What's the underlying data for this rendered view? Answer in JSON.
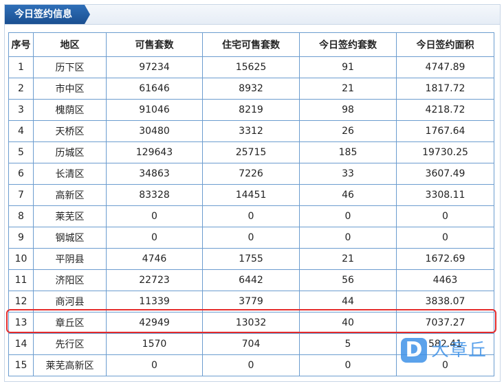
{
  "panel": {
    "title": "今日签约信息"
  },
  "table": {
    "headers": [
      "序号",
      "地区",
      "可售套数",
      "住宅可售套数",
      "今日签约套数",
      "今日签约面积"
    ],
    "rows": [
      [
        "1",
        "历下区",
        "97234",
        "15625",
        "91",
        "4747.89"
      ],
      [
        "2",
        "市中区",
        "61646",
        "8932",
        "21",
        "1817.72"
      ],
      [
        "3",
        "槐荫区",
        "91046",
        "8219",
        "98",
        "4218.72"
      ],
      [
        "4",
        "天桥区",
        "30480",
        "3312",
        "26",
        "1767.64"
      ],
      [
        "5",
        "历城区",
        "129643",
        "25715",
        "185",
        "19730.25"
      ],
      [
        "6",
        "长清区",
        "34863",
        "7226",
        "33",
        "3607.49"
      ],
      [
        "7",
        "高新区",
        "83328",
        "14451",
        "46",
        "3308.11"
      ],
      [
        "8",
        "莱芜区",
        "0",
        "0",
        "0",
        "0"
      ],
      [
        "9",
        "钢城区",
        "0",
        "0",
        "0",
        "0"
      ],
      [
        "10",
        "平阴县",
        "4746",
        "1755",
        "21",
        "1672.69"
      ],
      [
        "11",
        "济阳区",
        "22723",
        "6442",
        "56",
        "4463"
      ],
      [
        "12",
        "商河县",
        "11339",
        "3779",
        "44",
        "3838.07"
      ],
      [
        "13",
        "章丘区",
        "42949",
        "13032",
        "40",
        "7037.27"
      ],
      [
        "14",
        "先行区",
        "1570",
        "704",
        "5",
        "582.41"
      ],
      [
        "15",
        "莱芜高新区",
        "0",
        "0",
        "0",
        "0"
      ]
    ]
  },
  "watermark": {
    "logo_letter": "D",
    "text": "大章丘",
    "color": "#3f92e8"
  },
  "colors": {
    "tab": "#1a4f91",
    "border": "#6b9ccf",
    "highlight": "#e52b2b"
  }
}
